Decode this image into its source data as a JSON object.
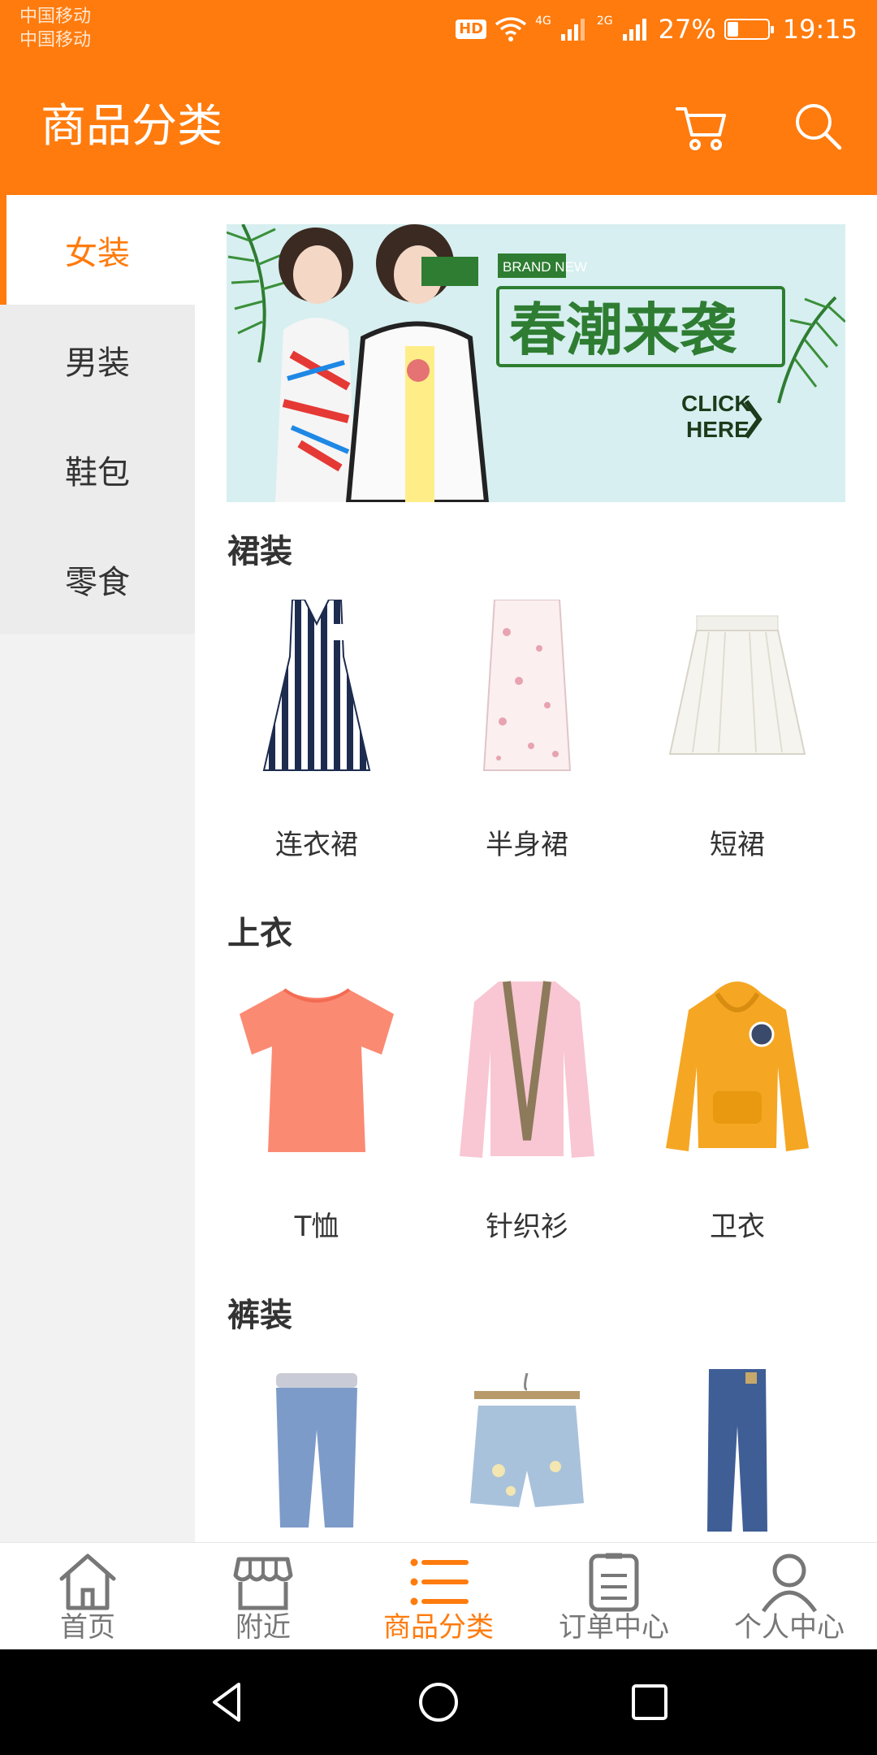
{
  "status_bar": {
    "carrier_1": "中国移动",
    "carrier_2": "中国移动",
    "hd": "HD",
    "net_4g": "4G",
    "net_2g": "2G",
    "battery_pct": "27%",
    "battery_level": 0.27,
    "time": "19:15"
  },
  "app_bar": {
    "title": "商品分类",
    "cart_icon": "cart-icon",
    "search_icon": "search-icon",
    "accent": "#ff7b0d"
  },
  "sidebar": {
    "items": [
      {
        "label": "女装",
        "active": true
      },
      {
        "label": "男装",
        "active": false
      },
      {
        "label": "鞋包",
        "active": false
      },
      {
        "label": "零食",
        "active": false
      }
    ]
  },
  "banner": {
    "brand_tag": "BRAND NEW",
    "headline": "春潮来袭",
    "cta_line1": "CLICK",
    "cta_line2": "HERE"
  },
  "sections": [
    {
      "title": "裙装",
      "items": [
        {
          "label": "连衣裙"
        },
        {
          "label": "半身裙"
        },
        {
          "label": "短裙"
        }
      ]
    },
    {
      "title": "上衣",
      "items": [
        {
          "label": "T恤"
        },
        {
          "label": "针织衫"
        },
        {
          "label": "卫衣"
        }
      ]
    },
    {
      "title": "裤装",
      "items": [
        {
          "label": ""
        },
        {
          "label": ""
        },
        {
          "label": ""
        }
      ]
    }
  ],
  "bottom_nav": {
    "items": [
      {
        "label": "首页",
        "icon": "home-icon",
        "active": false
      },
      {
        "label": "附近",
        "icon": "store-icon",
        "active": false
      },
      {
        "label": "商品分类",
        "icon": "list-icon",
        "active": true
      },
      {
        "label": "订单中心",
        "icon": "clipboard-icon",
        "active": false
      },
      {
        "label": "个人中心",
        "icon": "person-icon",
        "active": false
      }
    ]
  }
}
